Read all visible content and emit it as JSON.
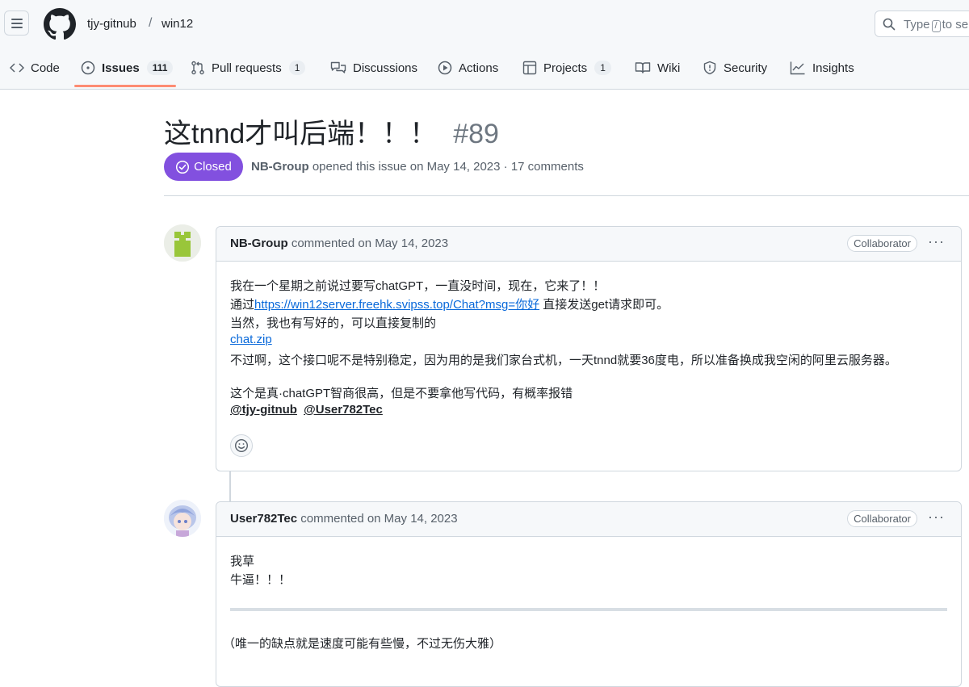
{
  "header": {
    "owner": "tjy-gitnub",
    "separator": "/",
    "repo": "win12",
    "search_placeholder_before": "Type",
    "search_key": "/",
    "search_placeholder_after": "to se"
  },
  "tabs": [
    {
      "label": "Code",
      "icon": "code-icon"
    },
    {
      "label": "Issues",
      "count": "111",
      "icon": "issue-opened-icon",
      "active": true
    },
    {
      "label": "Pull requests",
      "count": "1",
      "icon": "git-pull-request-icon"
    },
    {
      "label": "Discussions",
      "icon": "comment-discussion-icon"
    },
    {
      "label": "Actions",
      "icon": "play-icon"
    },
    {
      "label": "Projects",
      "count": "1",
      "icon": "table-icon"
    },
    {
      "label": "Wiki",
      "icon": "book-icon"
    },
    {
      "label": "Security",
      "icon": "shield-icon"
    },
    {
      "label": "Insights",
      "icon": "graph-icon"
    }
  ],
  "issue": {
    "title": "这tnnd才叫后端！！！",
    "number": "#89",
    "state": "Closed",
    "author": "NB-Group",
    "meta_text": "opened this issue on May 14, 2023 · 17 comments"
  },
  "comments": [
    {
      "author": "NB-Group",
      "action": "commented on May 14, 2023",
      "badge": "Collaborator",
      "menu": "···",
      "lines": {
        "l1": "我在一个星期之前说过要写chatGPT，一直没时间，现在，它来了！！",
        "l2_pre": "通过",
        "l2_link": "https://win12server.freehk.svipss.top/Chat?msg=你好",
        "l2_post": " 直接发送get请求即可。",
        "l3": "当然，我也有写好的，可以直接复制的",
        "l4_link": "chat.zip",
        "l5": "不过啊，这个接口呢不是特别稳定，因为用的是我们家台式机，一天tnnd就要36度电，所以准备换成我空闲的阿里云服务器。",
        "l6": "这个是真·chatGPT智商很高，但是不要拿他写代码，有概率报错",
        "mention1": "@tjy-gitnub",
        "mention2": "@User782Tec"
      }
    },
    {
      "author": "User782Tec",
      "action": "commented on May 14, 2023",
      "badge": "Collaborator",
      "menu": "···",
      "lines": {
        "l1": "我草",
        "l2": "牛逼！！！",
        "l3": "（唯一的缺点就是速度可能有些慢，不过无伤大雅）"
      }
    }
  ],
  "colors": {
    "closed": "#8250df",
    "link": "#0969da",
    "active_tab_underline": "#fd8c73"
  }
}
